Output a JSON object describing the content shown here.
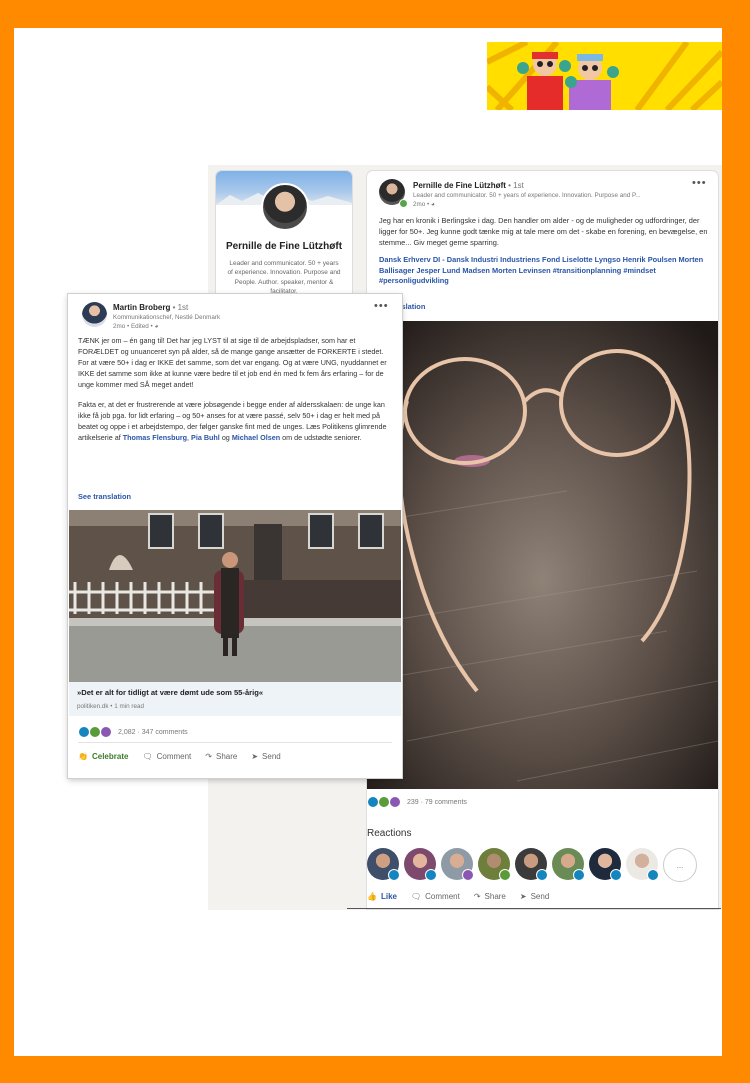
{
  "pernille_profile": {
    "name": "Pernille de Fine Lützhøft",
    "headline": "Leader and communicator. 50 + years of experience. Innovation. Purpose and People. Author. speaker, mentor & facilitator."
  },
  "pernille_post": {
    "author": "Pernille de Fine Lützhøft",
    "degree": "• 1st",
    "headline": "Leader and communicator. 50 + years of experience. Innovation. Purpose and P...",
    "time": "2mo •",
    "body": "Jeg har en kronik i Berlingske i dag. Den handler om alder - og de muligheder og udfordringer, der ligger for 50+. Jeg kunne godt tænke mig at tale mere om det - skabe en forening, en bevægelse, en stemme... Giv meget gerne sparring.",
    "tags": "Dansk Erhverv DI - Dansk Industri Industriens Fond Liselotte Lyngso Henrik Poulsen Morten Ballisager Jesper Lund Madsen Morten Levinsen #transitionplanning #mindset #personligudvikling",
    "translation": "nslation",
    "counts": "239 · 79 comments",
    "reactions_title": "Reactions",
    "more_reactors": "...",
    "actions": {
      "like": "Like",
      "comment": "Comment",
      "share": "Share",
      "send": "Send"
    }
  },
  "martin_post": {
    "author": "Martin Broberg",
    "degree": "• 1st",
    "title": "Kommunikationschef, Nestlé Denmark",
    "time": "2mo • Edited •",
    "para1": "TÆNK jer om – én gang til! Det har jeg LYST til at sige til de arbejdspladser, som har et FORÆLDET og unuanceret syn på alder, så de mange gange ansætter de FORKERTE i stedet. For at være 50+ i dag er IKKE det samme, som det var engang. Og at være UNG, nyuddannet er IKKE det samme som ikke at kunne være bedre til et job end én med fx fem års erfaring – for de unge kommer med SÅ meget andet!",
    "para2_a": "Fakta er, at det er frustrerende at være jobsøgende i begge ender af aldersskalaen: de unge kan ikke få job pga. for lidt erfaring – og 50+ anses for at være passé, selv 50+ i dag er helt med på beatet og oppe i et arbejdstempo, der følger ganske fint med de unges. Læs Politikens glimrende artikelserie af",
    "name1": "Thomas Flensburg",
    "sep1": ",",
    "name2": "Pia Buhl",
    "sep2": "og",
    "name3": "Michael Olsen",
    "para2_b": "om de udstødte seniorer.",
    "translation": "See translation",
    "link_title": "»Det er alt for tidligt at være dømt ude som 55-årig«",
    "link_source": "politiken.dk • 1 min read",
    "counts": "2,082 · 347 comments",
    "actions": {
      "celebrate": "Celebrate",
      "comment": "Comment",
      "share": "Share",
      "send": "Send"
    }
  },
  "colors": {
    "frame": "#ff8a00",
    "link": "#2a55a8",
    "celebrate": "#3c7a2a"
  }
}
